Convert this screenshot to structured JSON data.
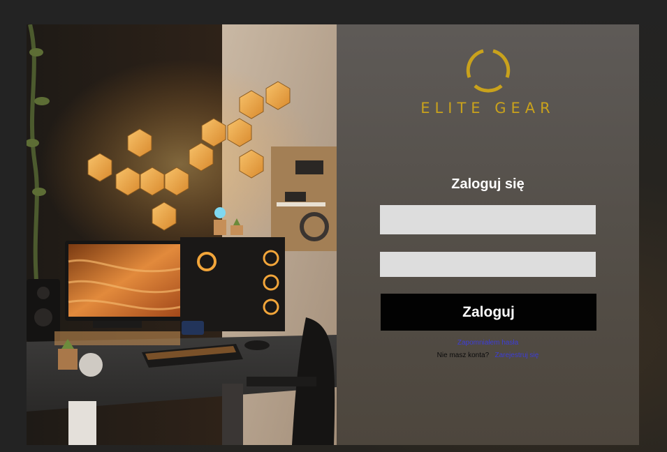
{
  "brand": {
    "name": "ELITE GEAR",
    "color": "#c9a21c"
  },
  "hero": {
    "image": "gaming-desk-setup-photo"
  },
  "login": {
    "title": "Zaloguj się",
    "username_value": "",
    "password_value": "",
    "submit_label": "Zaloguj",
    "forgot_label": "Zapomniałem hasła",
    "no_account_text": "Nie masz konta?",
    "register_label": "Zarejestruj się"
  },
  "colors": {
    "link": "#3d3dd6",
    "button_bg": "#020202",
    "input_bg": "#dddddd"
  }
}
